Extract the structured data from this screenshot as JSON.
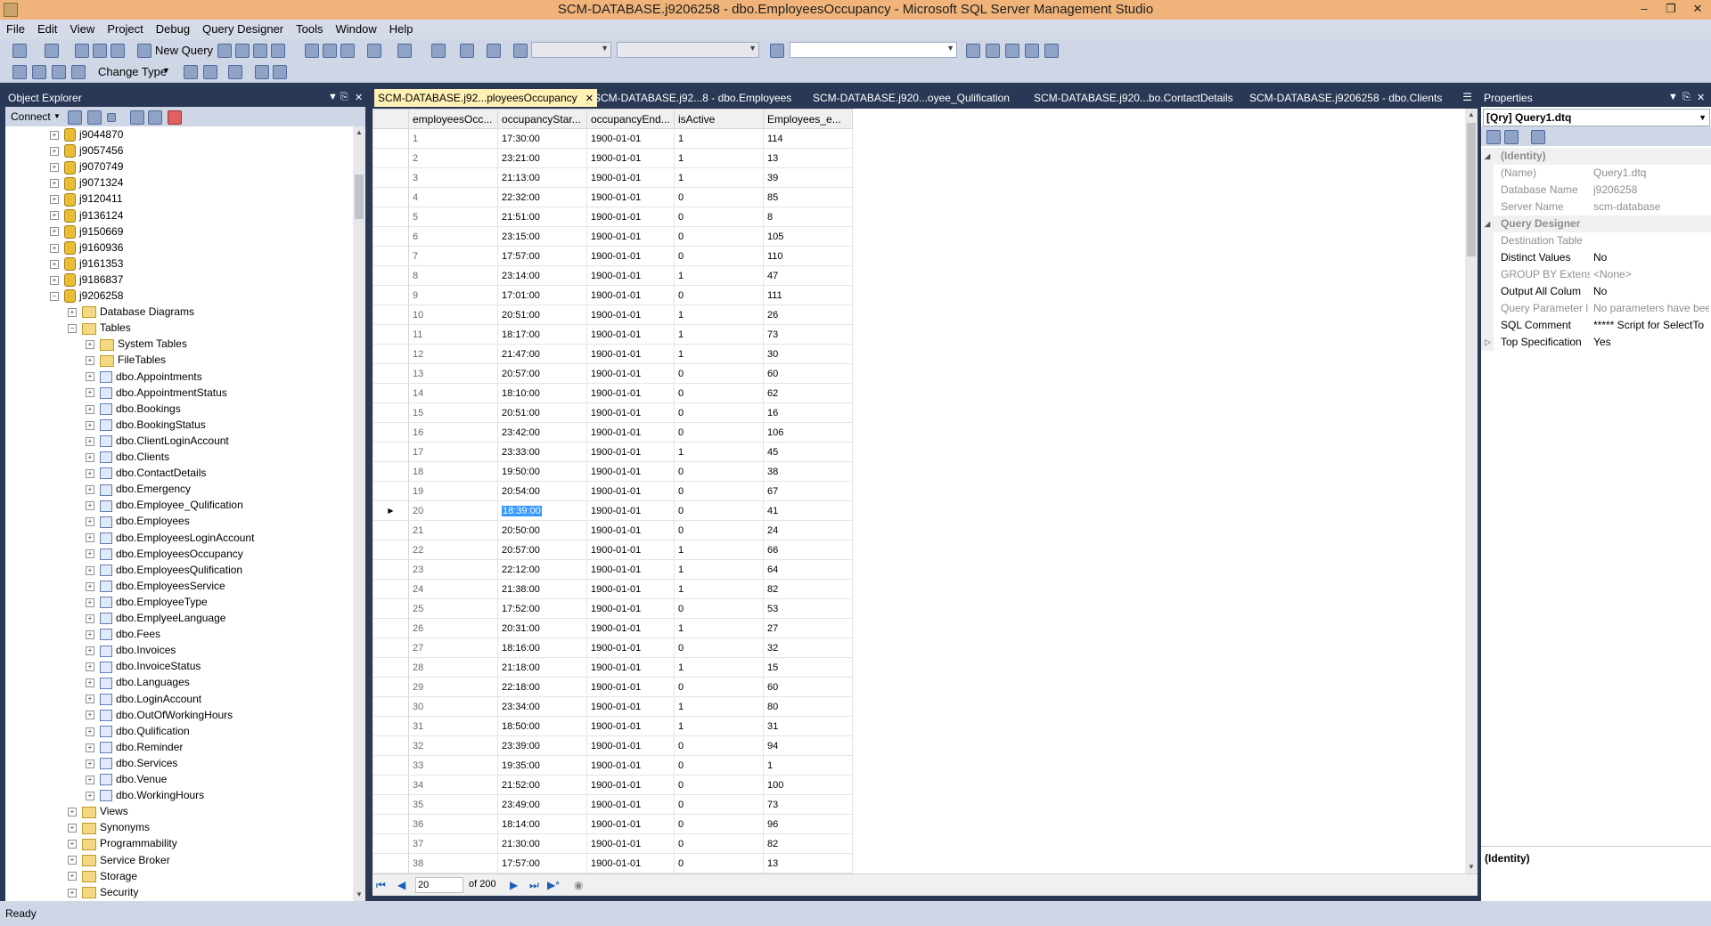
{
  "window": {
    "title": "SCM-DATABASE.j9206258 - dbo.EmployeesOccupancy - Microsoft SQL Server Management Studio"
  },
  "menu": [
    "File",
    "Edit",
    "View",
    "Project",
    "Debug",
    "Query Designer",
    "Tools",
    "Window",
    "Help"
  ],
  "toolbar": {
    "new_query": "New Query",
    "change_type": "Change Type"
  },
  "object_explorer": {
    "title": "Object Explorer",
    "connect": "Connect",
    "nodes": [
      {
        "label": "j9044870",
        "level": 0,
        "icon": "db",
        "exp": "+"
      },
      {
        "label": "j9057456",
        "level": 0,
        "icon": "db",
        "exp": "+"
      },
      {
        "label": "j9070749",
        "level": 0,
        "icon": "db",
        "exp": "+"
      },
      {
        "label": "j9071324",
        "level": 0,
        "icon": "db",
        "exp": "+"
      },
      {
        "label": "j9120411",
        "level": 0,
        "icon": "db",
        "exp": "+"
      },
      {
        "label": "j9136124",
        "level": 0,
        "icon": "db",
        "exp": "+"
      },
      {
        "label": "j9150669",
        "level": 0,
        "icon": "db",
        "exp": "+"
      },
      {
        "label": "j9160936",
        "level": 0,
        "icon": "db",
        "exp": "+"
      },
      {
        "label": "j9161353",
        "level": 0,
        "icon": "db",
        "exp": "+"
      },
      {
        "label": "j9186837",
        "level": 0,
        "icon": "db",
        "exp": "+"
      },
      {
        "label": "j9206258",
        "level": 0,
        "icon": "db",
        "exp": "-"
      },
      {
        "label": "Database Diagrams",
        "level": 1,
        "icon": "folder",
        "exp": "+"
      },
      {
        "label": "Tables",
        "level": 1,
        "icon": "folder",
        "exp": "-"
      },
      {
        "label": "System Tables",
        "level": 2,
        "icon": "folder",
        "exp": "+"
      },
      {
        "label": "FileTables",
        "level": 2,
        "icon": "folder",
        "exp": "+"
      },
      {
        "label": "dbo.Appointments",
        "level": 2,
        "icon": "table",
        "exp": "+"
      },
      {
        "label": "dbo.AppointmentStatus",
        "level": 2,
        "icon": "table",
        "exp": "+"
      },
      {
        "label": "dbo.Bookings",
        "level": 2,
        "icon": "table",
        "exp": "+"
      },
      {
        "label": "dbo.BookingStatus",
        "level": 2,
        "icon": "table",
        "exp": "+"
      },
      {
        "label": "dbo.ClientLoginAccount",
        "level": 2,
        "icon": "table",
        "exp": "+"
      },
      {
        "label": "dbo.Clients",
        "level": 2,
        "icon": "table",
        "exp": "+"
      },
      {
        "label": "dbo.ContactDetails",
        "level": 2,
        "icon": "table",
        "exp": "+"
      },
      {
        "label": "dbo.Emergency",
        "level": 2,
        "icon": "table",
        "exp": "+"
      },
      {
        "label": "dbo.Employee_Qulification",
        "level": 2,
        "icon": "table",
        "exp": "+"
      },
      {
        "label": "dbo.Employees",
        "level": 2,
        "icon": "table",
        "exp": "+"
      },
      {
        "label": "dbo.EmployeesLoginAccount",
        "level": 2,
        "icon": "table",
        "exp": "+"
      },
      {
        "label": "dbo.EmployeesOccupancy",
        "level": 2,
        "icon": "table",
        "exp": "+"
      },
      {
        "label": "dbo.EmployeesQulification",
        "level": 2,
        "icon": "table",
        "exp": "+"
      },
      {
        "label": "dbo.EmployeesService",
        "level": 2,
        "icon": "table",
        "exp": "+"
      },
      {
        "label": "dbo.EmployeeType",
        "level": 2,
        "icon": "table",
        "exp": "+"
      },
      {
        "label": "dbo.EmplyeeLanguage",
        "level": 2,
        "icon": "table",
        "exp": "+"
      },
      {
        "label": "dbo.Fees",
        "level": 2,
        "icon": "table",
        "exp": "+"
      },
      {
        "label": "dbo.Invoices",
        "level": 2,
        "icon": "table",
        "exp": "+"
      },
      {
        "label": "dbo.InvoiceStatus",
        "level": 2,
        "icon": "table",
        "exp": "+"
      },
      {
        "label": "dbo.Languages",
        "level": 2,
        "icon": "table",
        "exp": "+"
      },
      {
        "label": "dbo.LoginAccount",
        "level": 2,
        "icon": "table",
        "exp": "+"
      },
      {
        "label": "dbo.OutOfWorkingHours",
        "level": 2,
        "icon": "table",
        "exp": "+"
      },
      {
        "label": "dbo.Qulification",
        "level": 2,
        "icon": "table",
        "exp": "+"
      },
      {
        "label": "dbo.Reminder",
        "level": 2,
        "icon": "table",
        "exp": "+"
      },
      {
        "label": "dbo.Services",
        "level": 2,
        "icon": "table",
        "exp": "+"
      },
      {
        "label": "dbo.Venue",
        "level": 2,
        "icon": "table",
        "exp": "+"
      },
      {
        "label": "dbo.WorkingHours",
        "level": 2,
        "icon": "table",
        "exp": "+"
      },
      {
        "label": "Views",
        "level": 1,
        "icon": "folder",
        "exp": "+"
      },
      {
        "label": "Synonyms",
        "level": 1,
        "icon": "folder",
        "exp": "+"
      },
      {
        "label": "Programmability",
        "level": 1,
        "icon": "folder",
        "exp": "+"
      },
      {
        "label": "Service Broker",
        "level": 1,
        "icon": "folder",
        "exp": "+"
      },
      {
        "label": "Storage",
        "level": 1,
        "icon": "folder",
        "exp": "+"
      },
      {
        "label": "Security",
        "level": 1,
        "icon": "folder",
        "exp": "+"
      }
    ]
  },
  "tabs": [
    {
      "label": "SCM-DATABASE.j92...ployeesOccupancy",
      "active": true
    },
    {
      "label": "SCM-DATABASE.j92...8 - dbo.Employees",
      "active": false
    },
    {
      "label": "SCM-DATABASE.j920...oyee_Qulification",
      "active": false
    },
    {
      "label": "SCM-DATABASE.j920...bo.ContactDetails",
      "active": false
    },
    {
      "label": "SCM-DATABASE.j9206258 - dbo.Clients",
      "active": false
    }
  ],
  "grid": {
    "columns": [
      "employeesOcc...",
      "occupancyStar...",
      "occupancyEnd...",
      "isActive",
      "Employees_e..."
    ],
    "selected_row": 20,
    "rows": [
      [
        "1",
        "17:30:00",
        "1900-01-01",
        "1",
        "114"
      ],
      [
        "2",
        "23:21:00",
        "1900-01-01",
        "1",
        "13"
      ],
      [
        "3",
        "21:13:00",
        "1900-01-01",
        "1",
        "39"
      ],
      [
        "4",
        "22:32:00",
        "1900-01-01",
        "0",
        "85"
      ],
      [
        "5",
        "21:51:00",
        "1900-01-01",
        "0",
        "8"
      ],
      [
        "6",
        "23:15:00",
        "1900-01-01",
        "0",
        "105"
      ],
      [
        "7",
        "17:57:00",
        "1900-01-01",
        "0",
        "110"
      ],
      [
        "8",
        "23:14:00",
        "1900-01-01",
        "1",
        "47"
      ],
      [
        "9",
        "17:01:00",
        "1900-01-01",
        "0",
        "111"
      ],
      [
        "10",
        "20:51:00",
        "1900-01-01",
        "1",
        "26"
      ],
      [
        "11",
        "18:17:00",
        "1900-01-01",
        "1",
        "73"
      ],
      [
        "12",
        "21:47:00",
        "1900-01-01",
        "1",
        "30"
      ],
      [
        "13",
        "20:57:00",
        "1900-01-01",
        "0",
        "60"
      ],
      [
        "14",
        "18:10:00",
        "1900-01-01",
        "0",
        "62"
      ],
      [
        "15",
        "20:51:00",
        "1900-01-01",
        "0",
        "16"
      ],
      [
        "16",
        "23:42:00",
        "1900-01-01",
        "0",
        "106"
      ],
      [
        "17",
        "23:33:00",
        "1900-01-01",
        "1",
        "45"
      ],
      [
        "18",
        "19:50:00",
        "1900-01-01",
        "0",
        "38"
      ],
      [
        "19",
        "20:54:00",
        "1900-01-01",
        "0",
        "67"
      ],
      [
        "20",
        "18:39:00",
        "1900-01-01",
        "0",
        "41"
      ],
      [
        "21",
        "20:50:00",
        "1900-01-01",
        "0",
        "24"
      ],
      [
        "22",
        "20:57:00",
        "1900-01-01",
        "1",
        "66"
      ],
      [
        "23",
        "22:12:00",
        "1900-01-01",
        "1",
        "64"
      ],
      [
        "24",
        "21:38:00",
        "1900-01-01",
        "1",
        "82"
      ],
      [
        "25",
        "17:52:00",
        "1900-01-01",
        "0",
        "53"
      ],
      [
        "26",
        "20:31:00",
        "1900-01-01",
        "1",
        "27"
      ],
      [
        "27",
        "18:16:00",
        "1900-01-01",
        "0",
        "32"
      ],
      [
        "28",
        "21:18:00",
        "1900-01-01",
        "1",
        "15"
      ],
      [
        "29",
        "22:18:00",
        "1900-01-01",
        "0",
        "60"
      ],
      [
        "30",
        "23:34:00",
        "1900-01-01",
        "1",
        "80"
      ],
      [
        "31",
        "18:50:00",
        "1900-01-01",
        "1",
        "31"
      ],
      [
        "32",
        "23:39:00",
        "1900-01-01",
        "0",
        "94"
      ],
      [
        "33",
        "19:35:00",
        "1900-01-01",
        "0",
        "1"
      ],
      [
        "34",
        "21:52:00",
        "1900-01-01",
        "0",
        "100"
      ],
      [
        "35",
        "23:49:00",
        "1900-01-01",
        "0",
        "73"
      ],
      [
        "36",
        "18:14:00",
        "1900-01-01",
        "0",
        "96"
      ],
      [
        "37",
        "21:30:00",
        "1900-01-01",
        "0",
        "82"
      ],
      [
        "38",
        "17:57:00",
        "1900-01-01",
        "0",
        "13"
      ]
    ]
  },
  "nav": {
    "current": "20",
    "of": "of 200"
  },
  "properties": {
    "title": "Properties",
    "object": "[Qry] Query1.dtq",
    "rows": [
      {
        "type": "cat",
        "name": "(Identity)"
      },
      {
        "type": "ro",
        "name": "(Name)",
        "value": "Query1.dtq"
      },
      {
        "type": "ro",
        "name": "Database Name",
        "value": "j9206258"
      },
      {
        "type": "ro",
        "name": "Server Name",
        "value": "scm-database"
      },
      {
        "type": "cat",
        "name": "Query Designer"
      },
      {
        "type": "ro",
        "name": "Destination Table",
        "value": ""
      },
      {
        "type": "rw",
        "name": "Distinct Values",
        "value": "No"
      },
      {
        "type": "ro",
        "name": "GROUP BY Extensi",
        "value": "<None>"
      },
      {
        "type": "rw",
        "name": "Output All Colum",
        "value": "No"
      },
      {
        "type": "ro",
        "name": "Query Parameter l",
        "value": "No parameters have been"
      },
      {
        "type": "rw",
        "name": "SQL Comment",
        "value": "***** Script for SelectTo"
      },
      {
        "type": "rw",
        "name": "Top Specification",
        "value": "Yes"
      }
    ],
    "description": "(Identity)"
  },
  "status": {
    "text": "Ready"
  }
}
